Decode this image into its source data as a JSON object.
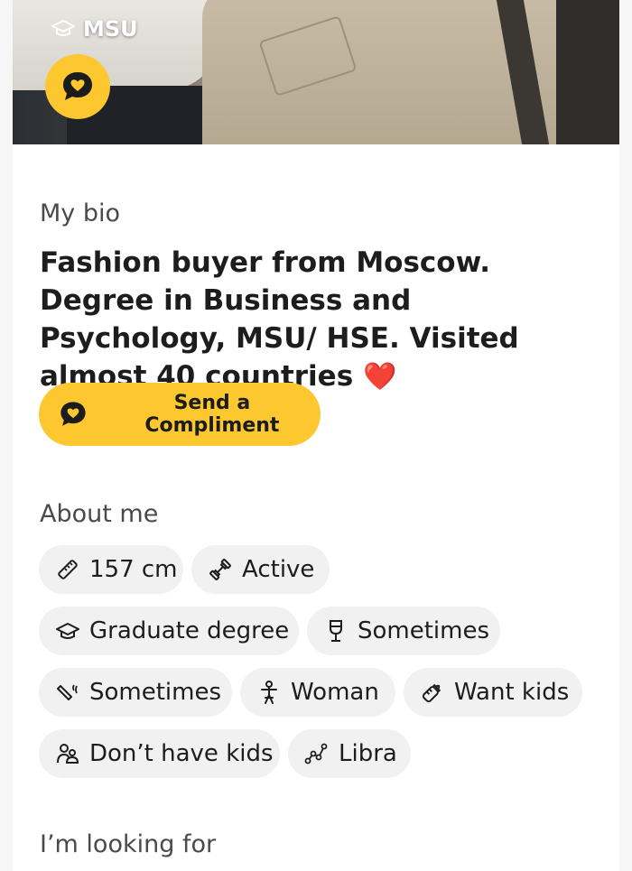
{
  "photo": {
    "school_label": "MSU",
    "school_icon": "graduation-cap-icon",
    "compliment_icon": "speech-bubble-heart-icon"
  },
  "bio": {
    "heading": "My bio",
    "text": "Fashion buyer from Moscow. Degree in Business and Psychology, MSU/ HSE. Visited almost 40 countries",
    "emoji": "❤️"
  },
  "compliment_button": {
    "label": "Send a Compliment",
    "icon": "speech-bubble-heart-icon"
  },
  "about": {
    "heading": "About me",
    "chips": [
      {
        "icon": "ruler-icon",
        "label": "157 cm"
      },
      {
        "icon": "dumbbell-icon",
        "label": "Active"
      },
      {
        "icon": "graduation-cap-icon",
        "label": "Graduate degree"
      },
      {
        "icon": "wine-glass-icon",
        "label": "Sometimes"
      },
      {
        "icon": "cigarette-icon",
        "label": "Sometimes"
      },
      {
        "icon": "person-icon",
        "label": "Woman"
      },
      {
        "icon": "baby-bottle-icon",
        "label": "Want kids"
      },
      {
        "icon": "family-icon",
        "label": "Don’t have kids"
      },
      {
        "icon": "zodiac-icon",
        "label": "Libra"
      }
    ]
  },
  "looking_for": {
    "heading": "I’m looking for"
  },
  "colors": {
    "accent": "#fdc82f",
    "chip_bg": "#f1f1f1",
    "heart": "#e0192b"
  }
}
